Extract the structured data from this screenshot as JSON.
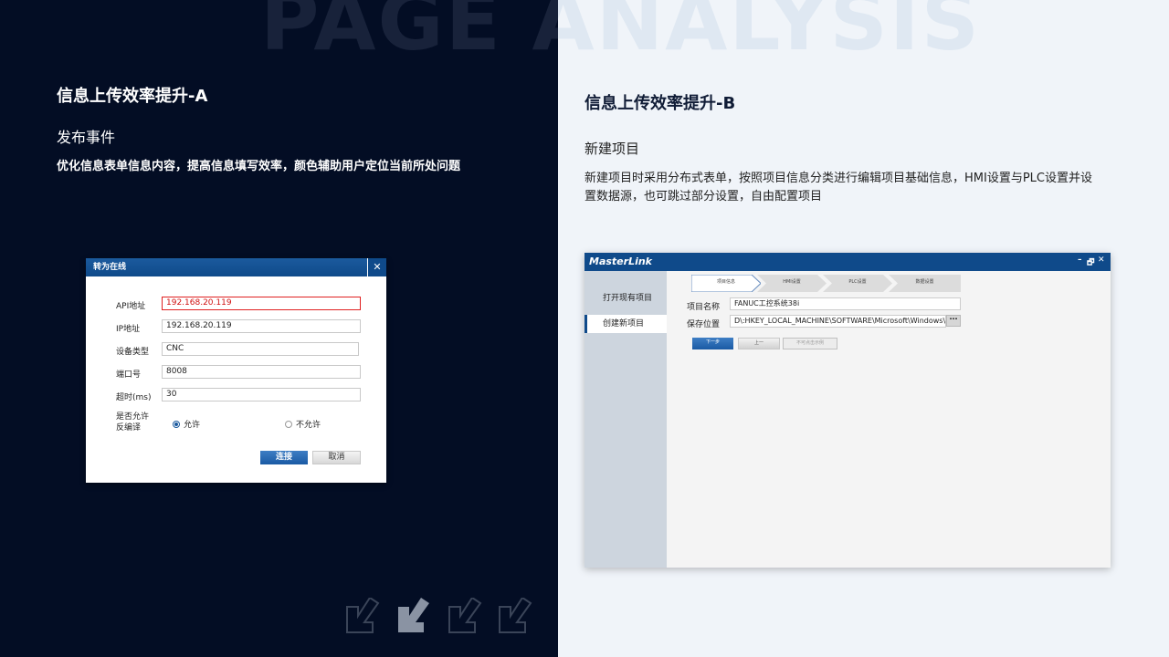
{
  "background_title": "PAGE ANALYSIS",
  "left": {
    "heading": "信息上传效率提升-A",
    "subheading": "发布事件",
    "description": "优化信息表单信息内容，提高信息填写效率，颜色辅助用户定位当前所处问题",
    "dialog": {
      "title": "转为在线",
      "close": "✕",
      "fields": [
        {
          "label": "API地址",
          "value": "192.168.20.119"
        },
        {
          "label": "IP地址",
          "value": "192.168.20.119"
        },
        {
          "label": "设备类型",
          "value": "CNC"
        },
        {
          "label": "端口号",
          "value": "8008"
        },
        {
          "label": "超时(ms)",
          "value": "30"
        }
      ],
      "decompile_label_line1": "是否允许",
      "decompile_label_line2": "反编译",
      "radio_allow": "允许",
      "radio_deny": "不允许",
      "connect_button": "连接",
      "cancel_button": "取消"
    }
  },
  "right": {
    "heading": "信息上传效率提升-B",
    "subheading": "新建项目",
    "description": "新建项目时采用分布式表单，按照项目信息分类进行编辑项目基础信息，HMI设置与PLC设置并设置数据源，也可跳过部分设置，自由配置项目",
    "window": {
      "title": "MasterLink",
      "controls": [
        "–",
        "🗗",
        "✕"
      ],
      "sidebar": [
        "打开现有项目",
        "创建新项目"
      ],
      "steps": [
        "项目信息",
        "HMI设置",
        "PLC设置",
        "数据设置"
      ],
      "name_label": "项目名称",
      "name_value": "FANUC工控系统38i",
      "path_label": "保存位置",
      "path_value": "D\\:HKEY_LOCAL_MACHINE\\SOFTWARE\\Microsoft\\Windows\\",
      "browse": "···",
      "btn_next": "下一步",
      "btn_prev": "上一",
      "btn_example": "不可点击示例"
    }
  },
  "colors": {
    "dark_bg": "#030d24",
    "light_bg": "#f0f4f9",
    "accent": "#0f4a8a",
    "error": "#e02020"
  }
}
